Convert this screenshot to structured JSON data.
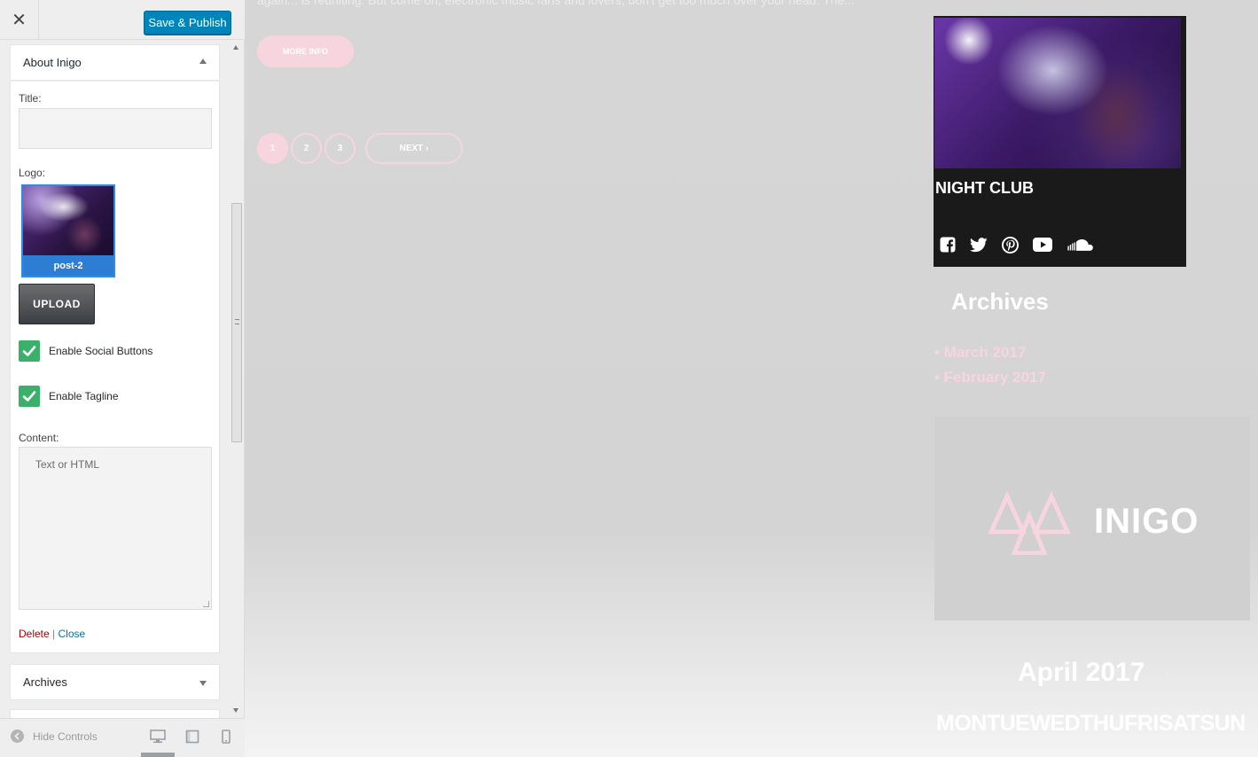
{
  "sidebar": {
    "close_symbol": "✕",
    "publish_label": "Save & Publish",
    "widget": {
      "title": "About Inigo",
      "title_label": "Title:",
      "title_value": "",
      "logo_label": "Logo:",
      "logo_caption": "post-2",
      "upload_label": "UPLOAD",
      "enable_social_label": "Enable Social Buttons",
      "enable_social_checked": true,
      "enable_tagline_label": "Enable Tagline",
      "enable_tagline_checked": true,
      "content_label": "Content:",
      "content_placeholder": "Text or HTML",
      "delete_label": "Delete",
      "separator": "|",
      "close_label": "Close"
    },
    "next_widget_title": "Archives",
    "footer": {
      "hide_controls_label": "Hide Controls",
      "devices": [
        "desktop",
        "tablet",
        "mobile"
      ],
      "active_device": "desktop"
    }
  },
  "preview": {
    "excerpt": "again... is reuniting. But come on, electronic music fans and lovers, don't get too much over your head. The...",
    "more_info_label": "MORE INFO",
    "pagination": {
      "pages": [
        "1",
        "2",
        "3"
      ],
      "current": "1",
      "next_label": "NEXT ›"
    },
    "about_card": {
      "title": "NIGHT CLUB",
      "social_icons": [
        "facebook-icon",
        "twitter-icon",
        "pinterest-icon",
        "youtube-icon",
        "soundcloud-icon"
      ]
    },
    "archives": {
      "title": "Archives",
      "items": [
        "• March 2017",
        "• February 2017"
      ]
    },
    "logo_text": "INIGO",
    "calendar": {
      "month": "April 2017",
      "next_symbol": "›",
      "days": "MONTUEWEDTHUFRISATSUN"
    }
  },
  "colors": {
    "accent_pink": "#f7d5df",
    "publish_blue": "#0085ba",
    "check_green": "#3ab06b",
    "preview_overlay": "#d6d6d6"
  }
}
